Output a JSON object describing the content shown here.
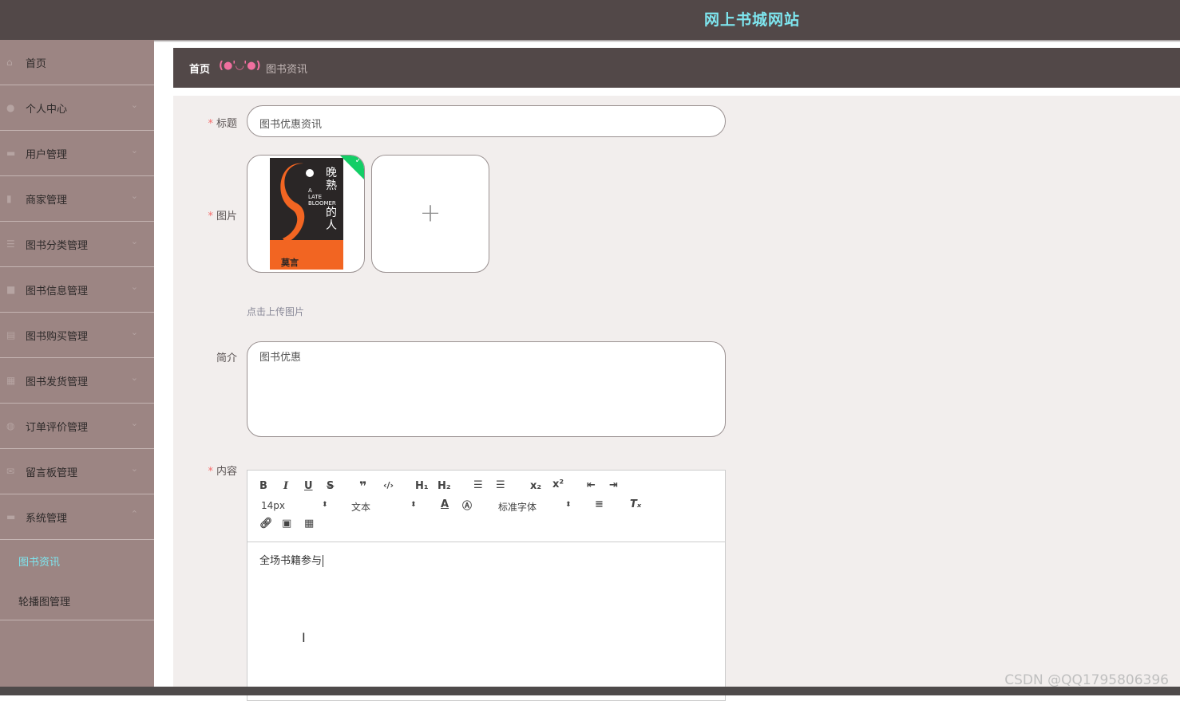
{
  "app": {
    "title": "网上书城网站"
  },
  "sidebar": {
    "items": [
      {
        "label": "首页",
        "icon": "home-icon"
      },
      {
        "label": "个人中心",
        "icon": "user-icon"
      },
      {
        "label": "用户管理",
        "icon": "users-icon"
      },
      {
        "label": "商家管理",
        "icon": "chart-icon"
      },
      {
        "label": "图书分类管理",
        "icon": "list-icon"
      },
      {
        "label": "图书信息管理",
        "icon": "book-icon"
      },
      {
        "label": "图书购买管理",
        "icon": "cart-icon"
      },
      {
        "label": "图书发货管理",
        "icon": "truck-icon"
      },
      {
        "label": "订单评价管理",
        "icon": "comment-icon"
      },
      {
        "label": "留言板管理",
        "icon": "mail-icon"
      },
      {
        "label": "系统管理",
        "icon": "settings-icon"
      }
    ],
    "submenu": [
      {
        "label": "图书资讯",
        "active": true
      },
      {
        "label": "轮播图管理",
        "active": false
      }
    ]
  },
  "breadcrumb": {
    "home": "首页",
    "separator": "(●'◡'●)",
    "current": "图书资讯"
  },
  "form": {
    "title_label": "标题",
    "title_value": "图书优惠资讯",
    "image_label": "图片",
    "upload_tip": "点击上传图片",
    "cover": {
      "title_cn": "晚熟的人",
      "title_en": "A LATE BLOOMER",
      "author": "莫言"
    },
    "intro_label": "简介",
    "intro_value": "图书优惠",
    "content_label": "内容",
    "content_value": "全场书籍参与"
  },
  "editor": {
    "font_size": "14px",
    "header_select": "文本",
    "font_family": "标准字体"
  },
  "watermark": "CSDN @QQ1795806396"
}
